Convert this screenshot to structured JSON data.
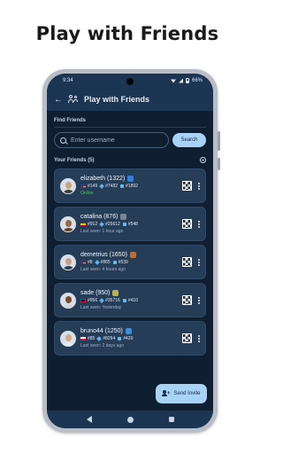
{
  "headline": "Play with Friends",
  "status_bar": {
    "time": "9:34",
    "battery": "66%"
  },
  "app_bar": {
    "title": "Play with Friends",
    "back_icon": "arrow-left-icon",
    "title_icon": "people-icon"
  },
  "find_friends": {
    "label": "Find Friends",
    "search_placeholder": "Enter username",
    "search_button": "Search"
  },
  "friends": {
    "label": "Your Friends (5)",
    "items": [
      {
        "name": "elizabeth (1322)",
        "flag": "us",
        "rank1": "#149",
        "rank2": "#7482",
        "rank3": "#1892",
        "last_seen": "Online",
        "online": true,
        "badge_color": "#3a7bd5",
        "avatar_bg": "#c8a27a",
        "shirt": "#3b3b3b"
      },
      {
        "name": "catalina (876)",
        "flag": "es",
        "rank1": "#912",
        "rank2": "#25612",
        "rank3": "#548",
        "last_seen": "Last seen: 1 hour ago",
        "online": false,
        "badge_color": "#7a8796",
        "avatar_bg": "#9a6a45",
        "shirt": "#6b3f2a"
      },
      {
        "name": "demetrius (1650)",
        "flag": "us",
        "rank1": "#8",
        "rank2": "#865",
        "rank3": "#539",
        "last_seen": "Last seen: 4 hours ago",
        "online": false,
        "badge_color": "#c76a2a",
        "avatar_bg": "#c99f84",
        "shirt": "#2f3b52"
      },
      {
        "name": "sade (950)",
        "flag": "gb",
        "rank1": "#956",
        "rank2": "#35716",
        "rank3": "#410",
        "last_seen": "Last seen: Yesterday",
        "online": false,
        "badge_color": "#c2b03d",
        "avatar_bg": "#7b4a33",
        "shirt": "#cfd6df"
      },
      {
        "name": "bruno44 (1250)",
        "flag": "pl",
        "rank1": "#85",
        "rank2": "#8264",
        "rank3": "#420",
        "last_seen": "Last seen: 2 days ago",
        "online": false,
        "badge_color": "#3f8fd1",
        "avatar_bg": "#d2a88a",
        "shirt": "#e8ecf0"
      }
    ]
  },
  "invite_button": {
    "label": "Send Invite",
    "icon": "add-person-icon"
  },
  "colors": {
    "background": "#0f1e30",
    "surface": "#263d58",
    "accent": "#a9d2f7",
    "online": "#45c95e"
  }
}
